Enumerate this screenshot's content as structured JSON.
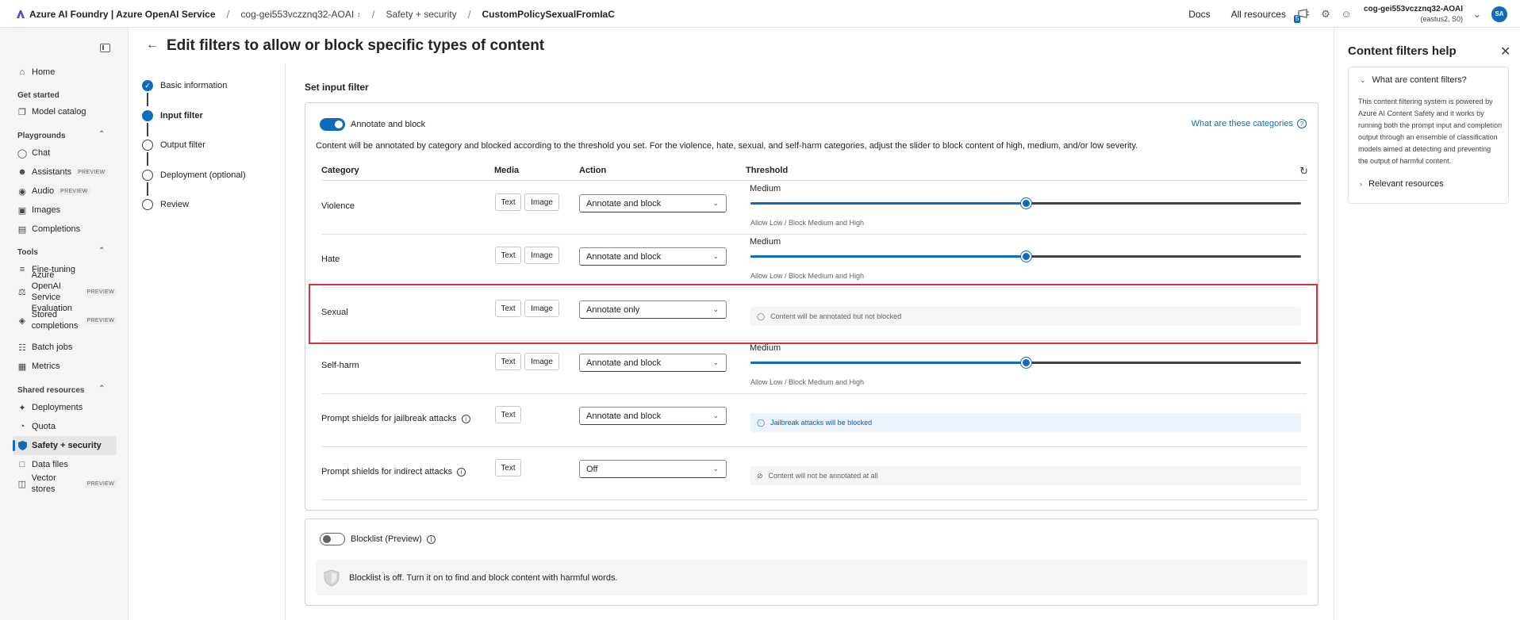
{
  "topbar": {
    "brand": "Azure AI Foundry | Azure OpenAI Service",
    "resource": "cog-gei553vczznq32-AOAI",
    "section": "Safety + security",
    "current": "CustomPolicySexualFromIaC",
    "docs": "Docs",
    "all_resources": "All resources",
    "notif_count": "5",
    "account_name": "cog-gei553vczznq32-AOAI",
    "account_sub": "(eastus2, S0)",
    "avatar": "SA"
  },
  "sidebar": {
    "home": "Home",
    "get_started": "Get started",
    "model_catalog": "Model catalog",
    "playgrounds": "Playgrounds",
    "chat": "Chat",
    "assistants": "Assistants",
    "audio": "Audio",
    "images": "Images",
    "completions": "Completions",
    "tools": "Tools",
    "fine_tuning": "Fine-tuning",
    "evaluation": "Azure OpenAI Service Evaluation",
    "stored": "Stored completions",
    "batch": "Batch jobs",
    "metrics": "Metrics",
    "shared": "Shared resources",
    "deployments": "Deployments",
    "quota": "Quota",
    "safety": "Safety + security",
    "data_files": "Data files",
    "vector_stores": "Vector stores",
    "preview": "PREVIEW"
  },
  "page": {
    "title": "Edit filters to allow or block specific types of content",
    "section_title": "Set input filter"
  },
  "steps": [
    "Basic information",
    "Input filter",
    "Output filter",
    "Deployment (optional)",
    "Review"
  ],
  "filter": {
    "mode_label": "Annotate and block",
    "help_link": "What are these categories",
    "description": "Content will be annotated by category and blocked according to the threshold you set. For the violence, hate, sexual, and self-harm categories, adjust the slider to block content of high, medium, and/or low severity.",
    "col_category": "Category",
    "col_media": "Media",
    "col_action": "Action",
    "col_threshold": "Threshold",
    "text_btn": "Text",
    "image_btn": "Image",
    "rows": [
      {
        "category": "Violence",
        "action": "Annotate and block",
        "threshold": "Medium",
        "threshold_note": "Allow Low / Block Medium and High",
        "level": 0.5
      },
      {
        "category": "Hate",
        "action": "Annotate and block",
        "threshold": "Medium",
        "threshold_note": "Allow Low / Block Medium and High",
        "level": 0.5
      },
      {
        "category": "Sexual",
        "action": "Annotate only",
        "info": "Content will be annotated but not blocked"
      },
      {
        "category": "Self-harm",
        "action": "Annotate and block",
        "threshold": "Medium",
        "threshold_note": "Allow Low / Block Medium and High",
        "level": 0.5
      },
      {
        "category": "Prompt shields for jailbreak attacks",
        "action": "Annotate and block",
        "info": "Jailbreak attacks will be blocked"
      },
      {
        "category": "Prompt shields for indirect attacks",
        "action": "Off",
        "info": "Content will not be annotated at all"
      }
    ]
  },
  "blocklist": {
    "label": "Blocklist (Preview)",
    "message": "Blocklist is off. Turn it on to find and block content with harmful words."
  },
  "help": {
    "title": "Content filters help",
    "q1": "What are content filters?",
    "a1": "This content filtering system is powered by Azure AI Content Safety and it works by running both the prompt input and completion output through an ensemble of classification models aimed at detecting and preventing the output of harmful content.",
    "q2": "Relevant resources"
  },
  "colors": {
    "accent": "#0f6cbd",
    "highlight": "#e0303a"
  }
}
